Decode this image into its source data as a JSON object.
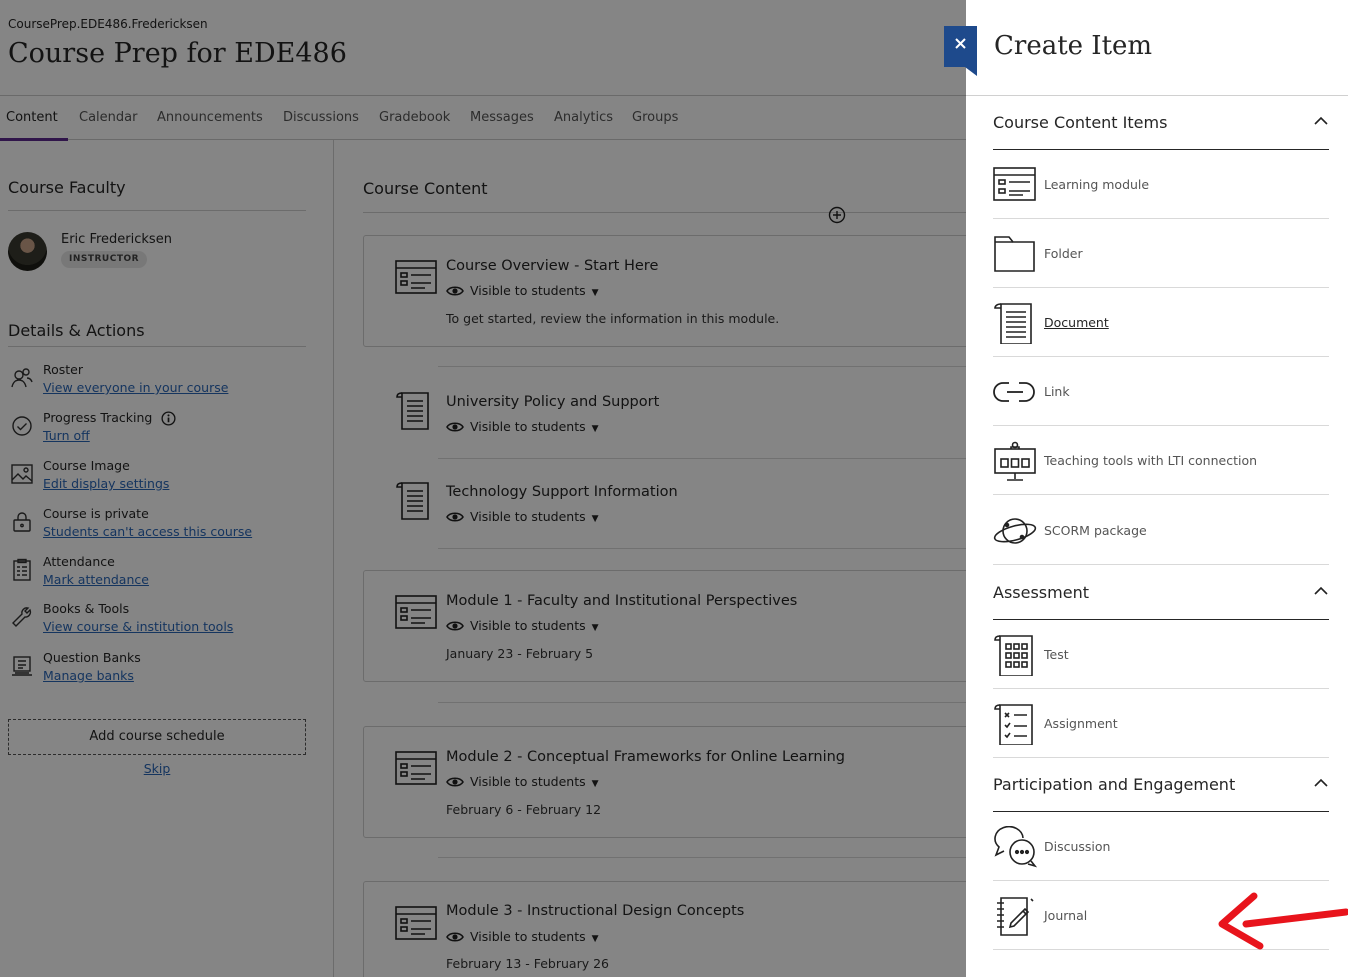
{
  "course": {
    "id": "CoursePrep.EDE486.Fredericksen",
    "title": "Course Prep for EDE486"
  },
  "tabs": [
    "Content",
    "Calendar",
    "Announcements",
    "Discussions",
    "Gradebook",
    "Messages",
    "Analytics",
    "Groups"
  ],
  "faculty": {
    "heading": "Course Faculty",
    "name": "Eric Fredericksen",
    "role": "INSTRUCTOR"
  },
  "details": {
    "heading": "Details & Actions",
    "actions": [
      {
        "title": "Roster",
        "link": "View everyone in your course",
        "icon": "roster-icon"
      },
      {
        "title": "Progress Tracking",
        "link": "Turn off",
        "icon": "progress-check-icon"
      },
      {
        "title": "Course Image",
        "link": "Edit display settings",
        "icon": "image-icon"
      },
      {
        "title": "Course is private",
        "link": "Students can't access this course",
        "icon": "lock-icon"
      },
      {
        "title": "Attendance",
        "link": "Mark attendance",
        "icon": "attendance-icon"
      },
      {
        "title": "Books & Tools",
        "link": "View course & institution tools",
        "icon": "wrench-icon"
      },
      {
        "title": "Question Banks",
        "link": "Manage banks",
        "icon": "question-bank-icon"
      }
    ],
    "schedule_button": "Add course schedule",
    "skip": "Skip"
  },
  "content": {
    "heading": "Course Content",
    "modules": [
      {
        "title": "Course Overview - Start Here",
        "visibility": "Visible to students",
        "desc": "To get started, review the information in this module.",
        "icon": "learning-module-icon"
      },
      {
        "title": "University Policy and Support",
        "visibility": "Visible to students",
        "desc": "",
        "icon": "document-icon"
      },
      {
        "title": "Technology Support Information",
        "visibility": "Visible to students",
        "desc": "",
        "icon": "document-icon"
      },
      {
        "title": "Module 1 - Faculty and Institutional Perspectives",
        "visibility": "Visible to students",
        "desc": "January 23 - February 5",
        "icon": "learning-module-icon"
      },
      {
        "title": "Module 2 - Conceptual Frameworks for Online Learning",
        "visibility": "Visible to students",
        "desc": "February 6 - February 12",
        "icon": "learning-module-icon"
      },
      {
        "title": "Module 3 - Instructional Design Concepts",
        "visibility": "Visible to students",
        "desc": "February 13 - February 26",
        "icon": "learning-module-icon"
      }
    ]
  },
  "panel": {
    "close": "×",
    "title": "Create Item",
    "groups": [
      {
        "heading": "Course Content Items",
        "items": [
          {
            "label": "Learning module",
            "icon": "learning-module-icon"
          },
          {
            "label": "Folder",
            "icon": "folder-icon"
          },
          {
            "label": "Document",
            "icon": "document-icon"
          },
          {
            "label": "Link",
            "icon": "link-icon"
          },
          {
            "label": "Teaching tools with LTI connection",
            "icon": "lti-tools-icon"
          },
          {
            "label": "SCORM package",
            "icon": "scorm-icon"
          }
        ]
      },
      {
        "heading": "Assessment",
        "items": [
          {
            "label": "Test",
            "icon": "test-icon"
          },
          {
            "label": "Assignment",
            "icon": "assignment-icon"
          }
        ]
      },
      {
        "heading": "Participation and Engagement",
        "items": [
          {
            "label": "Discussion",
            "icon": "discussion-icon"
          },
          {
            "label": "Journal",
            "icon": "journal-icon"
          }
        ]
      }
    ]
  },
  "colors": {
    "accent_purple": "#5c2a8e",
    "link_blue": "#2a66b7",
    "close_blue": "#1e4a8c",
    "arrow_red": "#e8141c"
  }
}
